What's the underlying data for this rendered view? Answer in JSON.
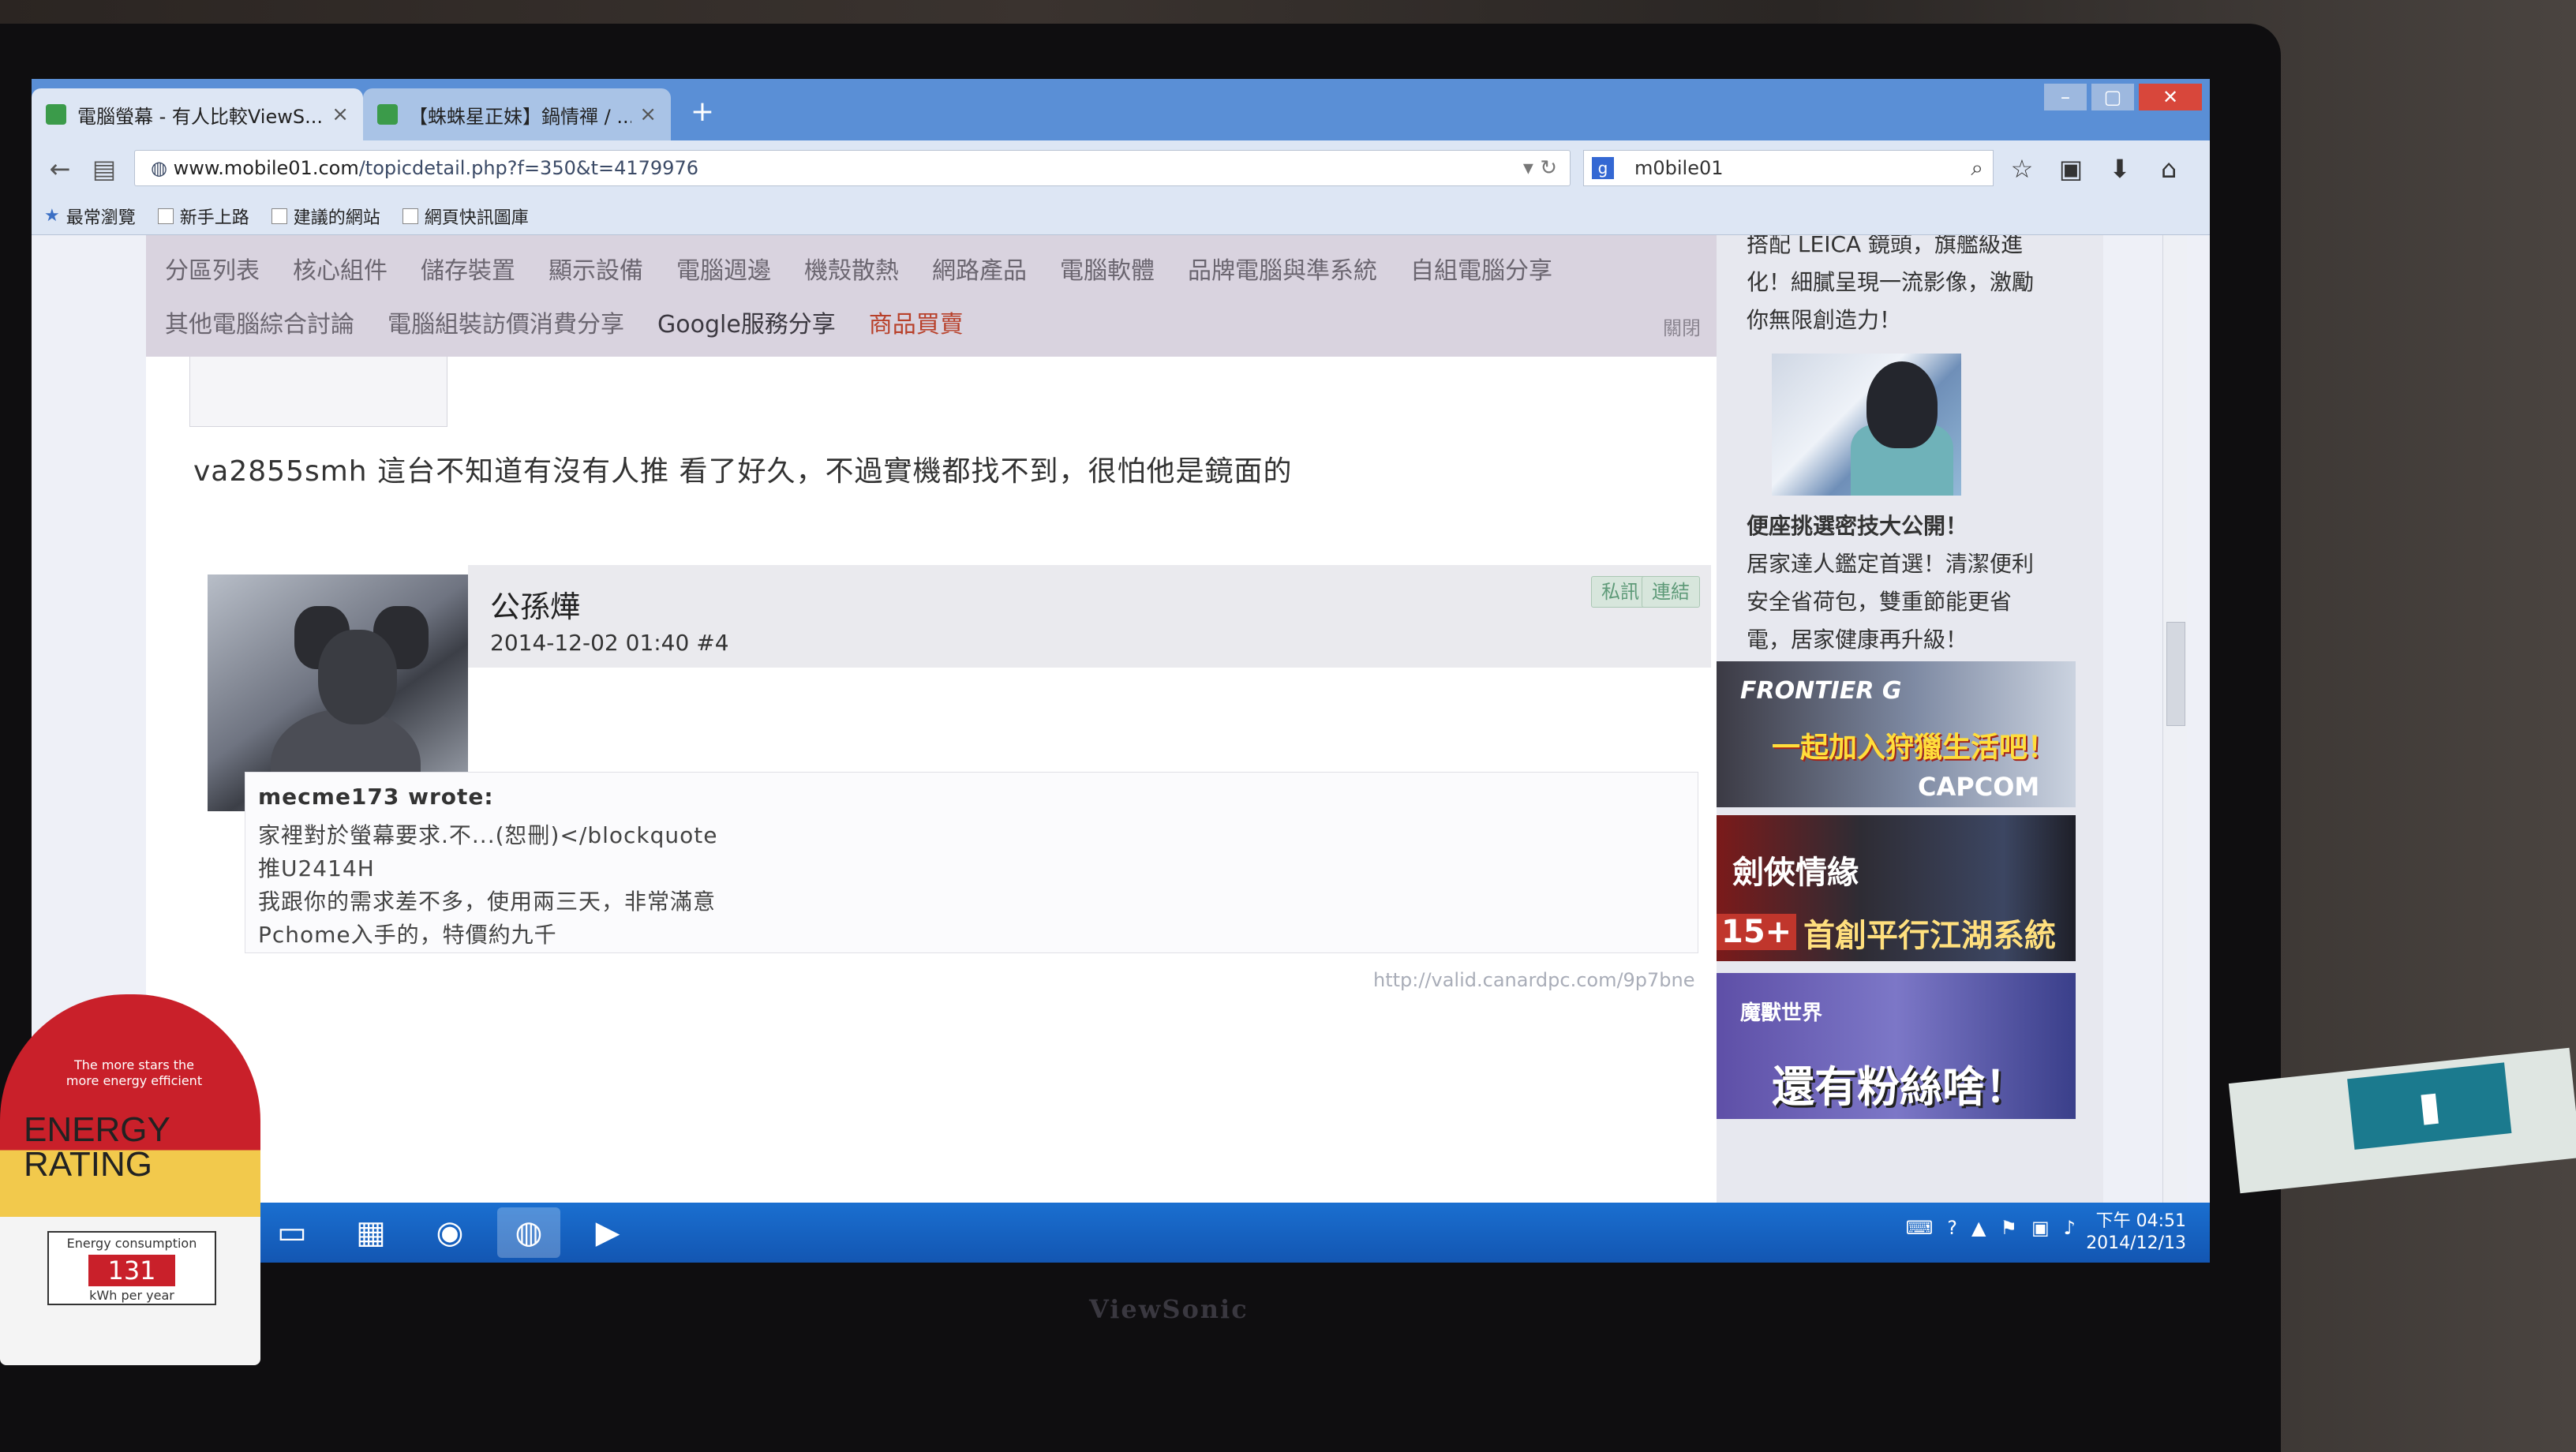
{
  "browser": {
    "tabs": [
      {
        "label": "電腦螢幕 - 有人比較ViewS..."
      },
      {
        "label": "【蛛蛛星正妹】鍋情禪 / ..."
      }
    ],
    "new_tab": "+",
    "url_host": "www.mobile01.com",
    "url_path": "/topicdetail.php?f=350&t=4179976",
    "search_value": "m0bile01",
    "bookmarks": [
      "最常瀏覽",
      "新手上路",
      "建議的網站",
      "網頁快訊圖庫"
    ]
  },
  "forum_nav": {
    "row1": [
      "分區列表",
      "核心組件",
      "儲存裝置",
      "顯示設備",
      "電腦週邊",
      "機殼散熱",
      "網路產品",
      "電腦軟體",
      "品牌電腦與準系統",
      "自組電腦分享"
    ],
    "row2": [
      "其他電腦綜合討論",
      "電腦組裝訪價消費分享",
      "Google服務分享",
      "商品買賣"
    ],
    "close_label": "關閉"
  },
  "post_prev": {
    "text": "va2855smh 這台不知道有沒有人推 看了好久，不過實機都找不到，很怕他是鏡面的"
  },
  "post": {
    "author": "公孫燁",
    "datetime": "2014-12-02 01:40",
    "floor": "#4",
    "pm_label": "私訊",
    "link_label": "連結",
    "quote_header": "mecme173 wrote:",
    "quote_lines": [
      "家裡對於螢幕要求.不...(恕刪)</blockquote",
      "推U2414H",
      "我跟你的需求差不多，使用兩三天，非常滿意",
      "Pchome入手的，特價約九千"
    ],
    "signature_url": "http://valid.canardpc.com/9p7bne"
  },
  "sidebar": {
    "top_text": [
      "搭配 LEICA 鏡頭，旗艦級進",
      "化！細膩呈現一流影像，激勵",
      "你無限創造力！"
    ],
    "article_title": "便座挑選密技大公開！",
    "article_body": [
      "居家達人鑑定首選！清潔便利",
      "安全省荷包，雙重節能更省",
      "電，居家健康再升級！"
    ],
    "ads": [
      {
        "line1": "FRONTIER G",
        "line2": "一起加入狩獵生活吧！",
        "line3": "CAPCOM"
      },
      {
        "line1": "劍俠情緣",
        "line2": "首創平行江湖系統",
        "badge": "15+"
      },
      {
        "line1": "魔獸世界",
        "line2": "還有粉絲啥！"
      }
    ]
  },
  "taskbar": {
    "time": "下午 04:51",
    "date": "2014/12/13"
  },
  "monitor": {
    "brand": "ViewSonic"
  },
  "energy_label": {
    "title1": "ENERGY",
    "title2": "RATING",
    "note": "The more stars the more energy efficient",
    "consumption_label": "Energy consumption",
    "consumption_value": "131",
    "unit": "kWh per year"
  },
  "colors": {
    "tabbar": "#5a8fd6",
    "taskbar": "#1356b2",
    "nav_bg": "#d9d3df",
    "sale_red": "#b8402a"
  }
}
